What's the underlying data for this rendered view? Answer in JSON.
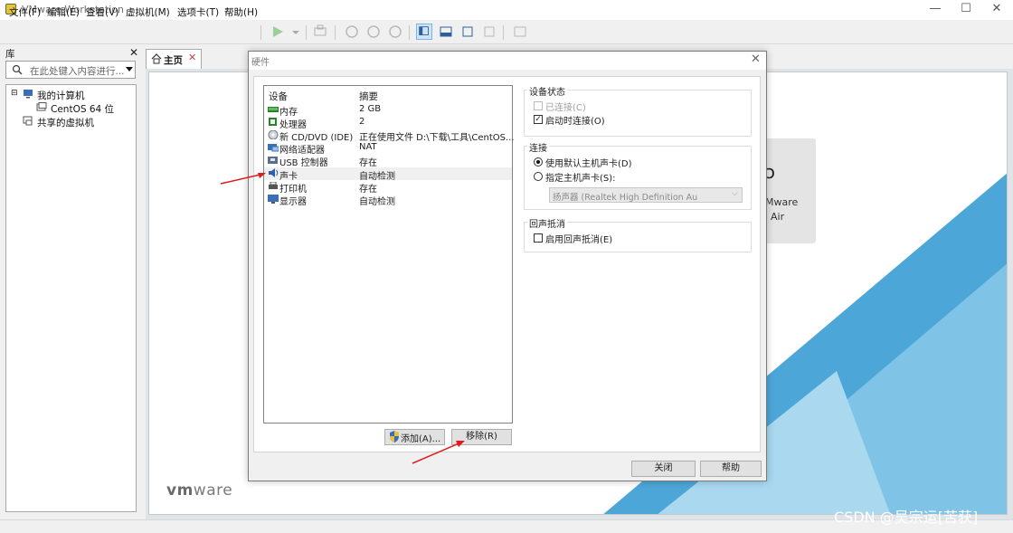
{
  "window": {
    "title": "VMware Workstation"
  },
  "menu": [
    "文件(F)",
    "编辑(E)",
    "查看(V)",
    "虚拟机(M)",
    "选项卡(T)",
    "帮助(H)"
  ],
  "library": {
    "title": "库",
    "search_placeholder": "在此处键入内容进行...",
    "tree": [
      {
        "label": "我的计算机",
        "expander": "⊟"
      },
      {
        "label": "CentOS 64 位"
      },
      {
        "label": "共享的虚拟机"
      }
    ]
  },
  "tabs": [
    {
      "label": "主页"
    }
  ],
  "home": {
    "tile_text_line1": "Mware",
    "tile_text_line2": "Air",
    "logo_vm": "vm",
    "logo_ware": "ware"
  },
  "dialog": {
    "title": "硬件",
    "list_headers": {
      "device": "设备",
      "summary": "摘要"
    },
    "devices": [
      {
        "icon": "memory-icon",
        "name": "内存",
        "summary": "2 GB"
      },
      {
        "icon": "processor-icon",
        "name": "处理器",
        "summary": "2"
      },
      {
        "icon": "cd-dvd-icon",
        "name": "新 CD/DVD (IDE)",
        "summary": "正在使用文件 D:\\下载\\工具\\CentOS..."
      },
      {
        "icon": "network-adapter-icon",
        "name": "网络适配器",
        "summary": "NAT"
      },
      {
        "icon": "usb-controller-icon",
        "name": "USB 控制器",
        "summary": "存在"
      },
      {
        "icon": "sound-card-icon",
        "name": "声卡",
        "summary": "自动检测",
        "selected": true
      },
      {
        "icon": "printer-icon",
        "name": "打印机",
        "summary": "存在"
      },
      {
        "icon": "display-icon",
        "name": "显示器",
        "summary": "自动检测"
      }
    ],
    "add_button": "添加(A)...",
    "remove_button": "移除(R)",
    "device_status": {
      "label": "设备状态",
      "connected": "已连接(C)",
      "connect_at_power_on": "启动时连接(O)"
    },
    "connection": {
      "label": "连接",
      "use_default": "使用默认主机声卡(D)",
      "specify": "指定主机声卡(S):",
      "combo_value": "扬声器 (Realtek High Definition Au"
    },
    "echo": {
      "label": "回声抵消",
      "enable": "启用回声抵消(E)"
    },
    "close_button": "关闭",
    "help_button": "帮助"
  },
  "watermark": "CSDN @吴宗运[苦获]",
  "colors": {
    "accent_blue": "#4da6d8",
    "arrow_red": "#e01b1b"
  }
}
